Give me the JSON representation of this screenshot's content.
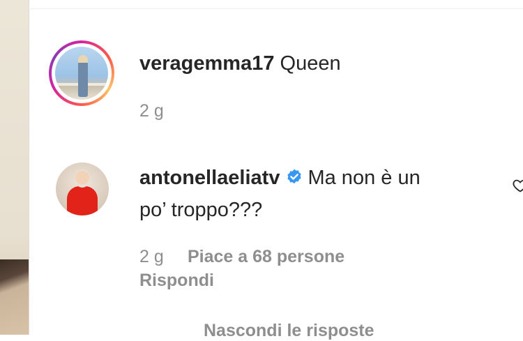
{
  "comments": [
    {
      "username": "veragemma17",
      "text": "Queen",
      "time": "2 g"
    },
    {
      "username": "antonellaeliatv",
      "text_line1": "Ma non è un",
      "text_line2": "po’ troppo???",
      "time": "2 g",
      "likes": "Piace a 68 persone",
      "reply": "Rispondi",
      "verified": true
    }
  ],
  "hide_replies": "Nascondi le risposte",
  "icons": {
    "verified": "verified-badge-icon",
    "like": "heart-icon"
  },
  "colors": {
    "verified": "#3897f0",
    "text": "#262626",
    "secondary": "#8e8e8e"
  }
}
